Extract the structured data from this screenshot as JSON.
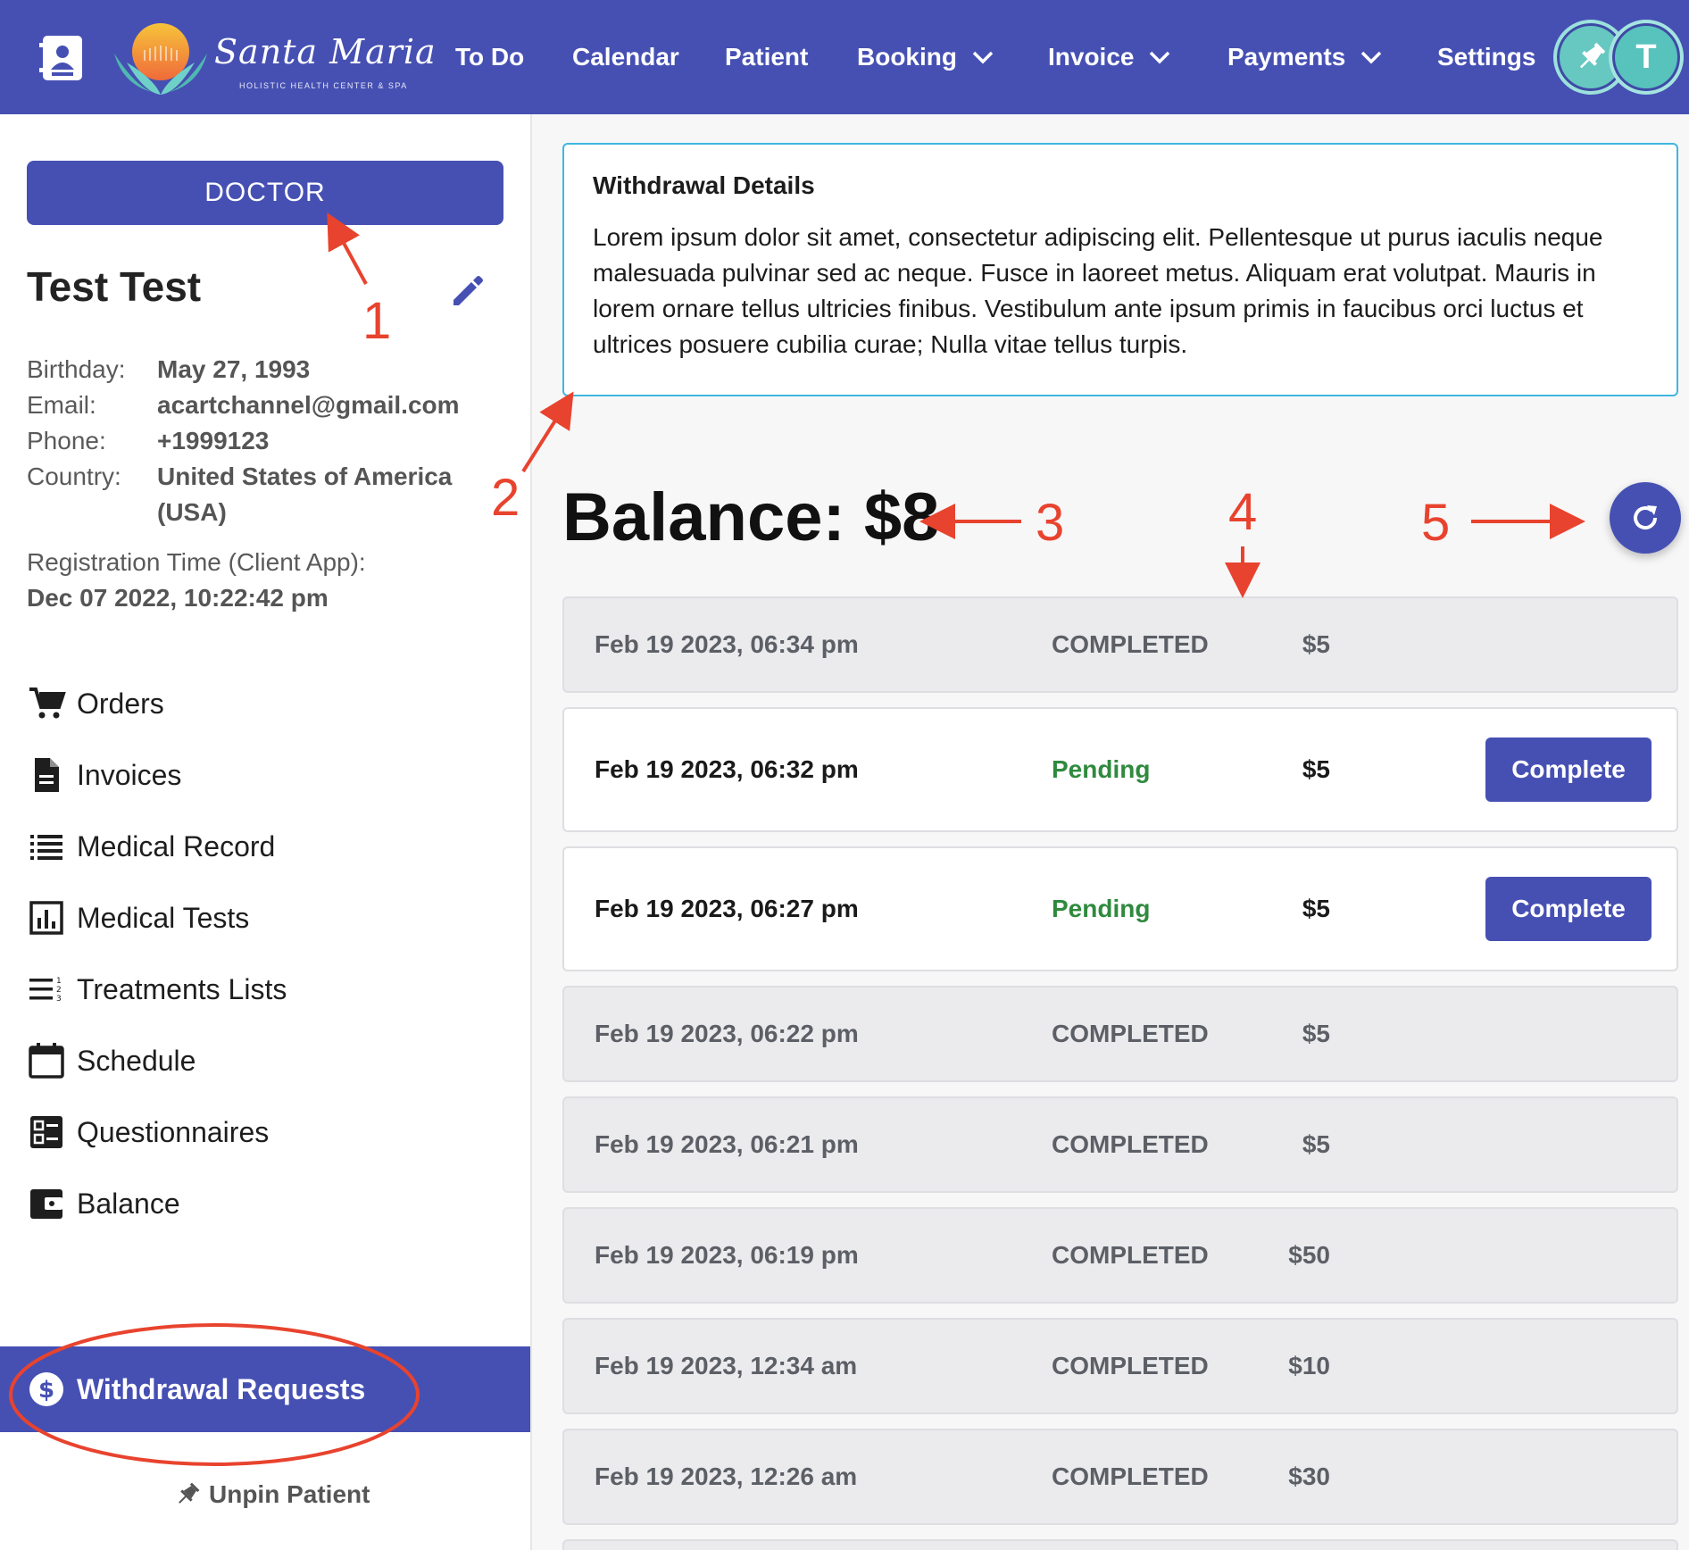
{
  "topbar": {
    "logo": {
      "script": "Santa Maria",
      "subtitle": "HOLISTIC HEALTH CENTER & SPA"
    },
    "nav": [
      {
        "label": "To Do"
      },
      {
        "label": "Calendar"
      },
      {
        "label": "Patient"
      },
      {
        "label": "Booking"
      },
      {
        "label": "Invoice"
      },
      {
        "label": "Payments"
      },
      {
        "label": "Settings"
      }
    ],
    "avatar_initial": "T",
    "icons": {
      "contacts": "contact-book-icon",
      "pin": "pin-icon",
      "dropdown": "chevron-down-icon"
    }
  },
  "sidebar": {
    "role_button": "DOCTOR",
    "patient_name": "Test Test",
    "info": [
      {
        "label": "Birthday:",
        "value": "May 27, 1993"
      },
      {
        "label": "Email:",
        "value": "acartchannel@gmail.com"
      },
      {
        "label": "Phone:",
        "value": "+1999123"
      },
      {
        "label": "Country:",
        "value": "United States of America",
        "value2": "(USA)"
      }
    ],
    "registration": {
      "label": "Registration Time (Client App):",
      "value": "Dec 07 2022, 10:22:42 pm"
    },
    "menu": [
      {
        "label": "Orders",
        "icon": "cart-icon"
      },
      {
        "label": "Invoices",
        "icon": "document-icon"
      },
      {
        "label": "Medical Record",
        "icon": "list-icon"
      },
      {
        "label": "Medical Tests",
        "icon": "bar-chart-icon"
      },
      {
        "label": "Treatments Lists",
        "icon": "numbered-list-icon"
      },
      {
        "label": "Schedule",
        "icon": "calendar-icon"
      },
      {
        "label": "Questionnaires",
        "icon": "checklist-icon"
      },
      {
        "label": "Balance",
        "icon": "wallet-icon"
      },
      {
        "label": "Withdrawal Requests",
        "icon": "dollar-circle-icon",
        "active": true
      }
    ],
    "unpin": "Unpin Patient"
  },
  "main": {
    "details": {
      "title": "Withdrawal Details",
      "body": "Lorem ipsum dolor sit amet, consectetur adipiscing elit. Pellentesque ut purus iaculis neque malesuada pulvinar sed ac neque. Fusce in laoreet metus. Aliquam erat volutpat. Mauris in lorem ornare tellus ultricies finibus. Vestibulum ante ipsum primis in faucibus orci luctus et ultrices posuere cubilia curae; Nulla vitae tellus turpis."
    },
    "balance": "Balance: $8",
    "refresh_icon": "refresh-icon",
    "complete_label": "Complete",
    "requests": [
      {
        "date": "Feb 19 2023, 06:34 pm",
        "status": "COMPLETED",
        "amount": "$5"
      },
      {
        "date": "Feb 19 2023, 06:32 pm",
        "status": "Pending",
        "amount": "$5"
      },
      {
        "date": "Feb 19 2023, 06:27 pm",
        "status": "Pending",
        "amount": "$5"
      },
      {
        "date": "Feb 19 2023, 06:22 pm",
        "status": "COMPLETED",
        "amount": "$5"
      },
      {
        "date": "Feb 19 2023, 06:21 pm",
        "status": "COMPLETED",
        "amount": "$5"
      },
      {
        "date": "Feb 19 2023, 06:19 pm",
        "status": "COMPLETED",
        "amount": "$50"
      },
      {
        "date": "Feb 19 2023, 12:34 am",
        "status": "COMPLETED",
        "amount": "$10"
      },
      {
        "date": "Feb 19 2023, 12:26 am",
        "status": "COMPLETED",
        "amount": "$30"
      }
    ]
  },
  "annotations": [
    "1",
    "2",
    "3",
    "4",
    "5"
  ],
  "colors": {
    "primary": "#4650b3",
    "accent_border": "#3fb7df",
    "pending": "#2f8a3e",
    "annotation": "#e8432e",
    "completed_row": "#ebebed"
  }
}
